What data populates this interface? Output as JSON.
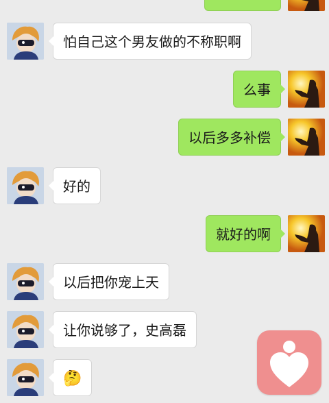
{
  "messages": [
    {
      "side": "right",
      "text": ""
    },
    {
      "side": "left",
      "text": "怕自己这个男友做的不称职啊"
    },
    {
      "side": "right",
      "text": "么事"
    },
    {
      "side": "right",
      "text": "以后多多补偿"
    },
    {
      "side": "left",
      "text": "好的"
    },
    {
      "side": "right",
      "text": "就好的啊"
    },
    {
      "side": "left",
      "text": "以后把你宠上天"
    },
    {
      "side": "left",
      "text": "让你说够了，史高磊"
    },
    {
      "side": "left",
      "text": "🤔"
    }
  ],
  "colors": {
    "background": "#ebebeb",
    "bubble_left": "#ffffff",
    "bubble_right": "#9fe75f",
    "fab": "#ef8f8f"
  },
  "icons": {
    "left_avatar": "cartoon-character-avatar-icon",
    "right_avatar": "sunset-silhouette-avatar-icon",
    "fab": "heart-person-icon"
  }
}
